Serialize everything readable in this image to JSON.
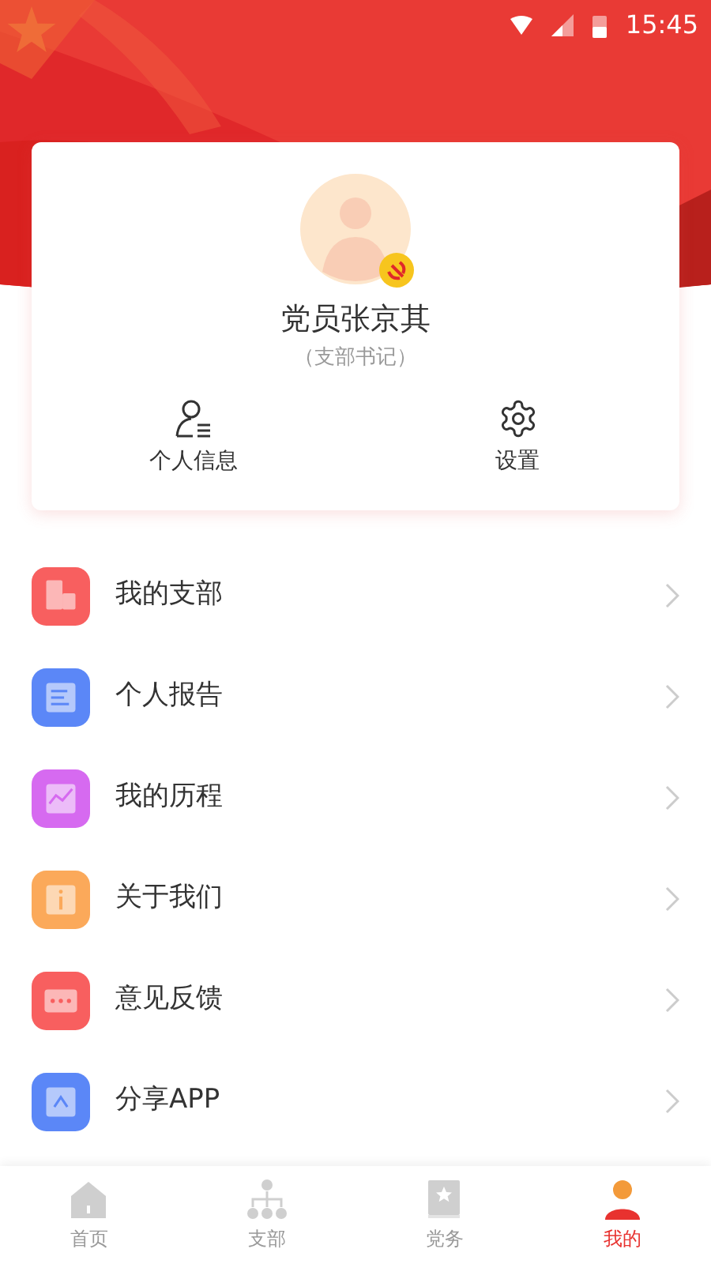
{
  "status_bar": {
    "time": "15:45"
  },
  "profile": {
    "name": "党员张京其",
    "role": "（支部书记）",
    "actions": [
      {
        "kind": "person",
        "label": "个人信息"
      },
      {
        "kind": "settings",
        "label": "设置"
      }
    ]
  },
  "menu": [
    {
      "kind": "building",
      "label": "我的支部",
      "color": "#f85f5f"
    },
    {
      "kind": "document",
      "label": "个人报告",
      "color": "#5b87f7"
    },
    {
      "kind": "chart",
      "label": "我的历程",
      "color": "#d66af0"
    },
    {
      "kind": "info",
      "label": "关于我们",
      "color": "#fba95a"
    },
    {
      "kind": "feedback",
      "label": "意见反馈",
      "color": "#f85f5f"
    },
    {
      "kind": "share",
      "label": "分享APP",
      "color": "#5b87f7"
    }
  ],
  "tabs": [
    {
      "kind": "home",
      "label": "首页",
      "selected": false
    },
    {
      "kind": "branch",
      "label": "支部",
      "selected": false
    },
    {
      "kind": "affairs",
      "label": "党务",
      "selected": false
    },
    {
      "kind": "me",
      "label": "我的",
      "selected": true
    }
  ]
}
